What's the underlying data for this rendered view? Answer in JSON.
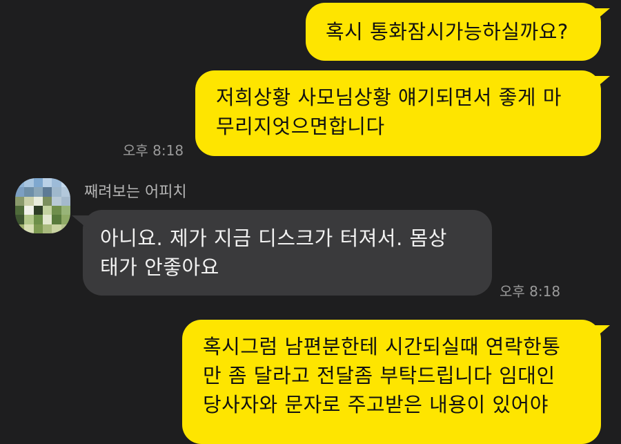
{
  "messages": [
    {
      "from": "me",
      "lines": [
        "혹시 통화잠시가능하실까요?"
      ]
    },
    {
      "from": "me",
      "lines": [
        "저희상황 사모님상황 얘기되면서 좋게 마",
        "무리지엇으면합니다"
      ],
      "time": "오후 8:18"
    },
    {
      "from": "them",
      "sender": "째려보는 어피치",
      "lines": [
        "아니요. 제가 지금 디스크가 터져서. 몸상",
        "태가 안좋아요"
      ],
      "time": "오후 8:18"
    },
    {
      "from": "me",
      "lines": [
        "혹시그럼 남편분한테 시간되실때 연락한통",
        "만 좀 달라고 전달좀 부탁드립니다 임대인",
        "당사자와 문자로 주고받은 내용이 있어야"
      ]
    }
  ],
  "colors": {
    "background": "#1e1e1f",
    "my_bubble": "#fee500",
    "their_bubble": "#3a3a3c",
    "timestamp": "#9a9a9a"
  },
  "avatar_pixels": [
    "#8fb4d6",
    "#a9c6e0",
    "#7fa8cf",
    "#b9d0e6",
    "#9dbbd8",
    "#c4d9ec",
    "#7c9fc2",
    "#6e8fa8",
    "#8aa6b8",
    "#5d7a95",
    "#9fb8cc",
    "#b3c8db",
    "#8a9a6c",
    "#c9cfa8",
    "#e9ecdc",
    "#7c8f5e",
    "#b8c9d6",
    "#a4b9cc",
    "#4f6b3a",
    "#f1f2ea",
    "#2e3d26",
    "#c3d2a0",
    "#6f8e4c",
    "#98b478",
    "#3e5530",
    "#b4c98c",
    "#6d8f49",
    "#e3e8d0",
    "#587a3c",
    "#8faa66",
    "#9fb06e",
    "#d8dfb4",
    "#7e9a52",
    "#a9ba7e",
    "#c9d3a2",
    "#b6c48e"
  ]
}
